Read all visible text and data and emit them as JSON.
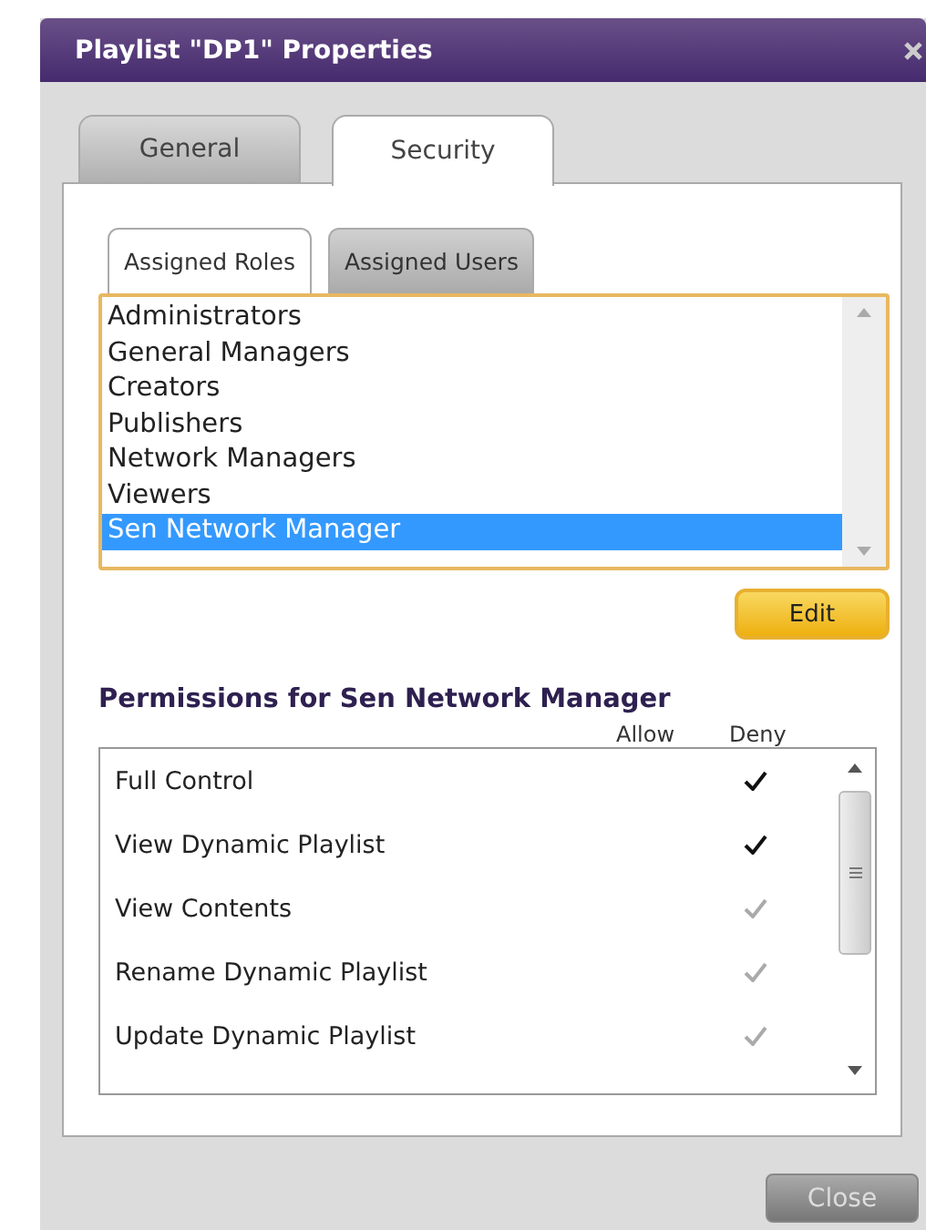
{
  "window": {
    "title": "Playlist \"DP1\" Properties"
  },
  "tabs": [
    {
      "label": "General",
      "selected": false
    },
    {
      "label": "Security",
      "selected": true
    }
  ],
  "subtabs": [
    {
      "label": "Assigned Roles",
      "selected": true
    },
    {
      "label": "Assigned Users",
      "selected": false
    }
  ],
  "roles": [
    {
      "name": "Administrators",
      "selected": false
    },
    {
      "name": "General Managers",
      "selected": false
    },
    {
      "name": "Creators",
      "selected": false
    },
    {
      "name": "Publishers",
      "selected": false
    },
    {
      "name": "Network Managers",
      "selected": false
    },
    {
      "name": "Viewers",
      "selected": false
    },
    {
      "name": "Sen Network Manager",
      "selected": true
    }
  ],
  "edit_button": "Edit",
  "permissions": {
    "title": "Permissions for Sen Network Manager",
    "columns": [
      "Allow",
      "Deny"
    ],
    "rows": [
      {
        "name": "Full Control",
        "deny": true,
        "disabled": false
      },
      {
        "name": "View Dynamic Playlist",
        "deny": true,
        "disabled": false
      },
      {
        "name": "View Contents",
        "deny": true,
        "disabled": true
      },
      {
        "name": "Rename Dynamic Playlist",
        "deny": true,
        "disabled": true
      },
      {
        "name": "Update Dynamic Playlist",
        "deny": true,
        "disabled": true
      }
    ]
  },
  "close_button": "Close"
}
